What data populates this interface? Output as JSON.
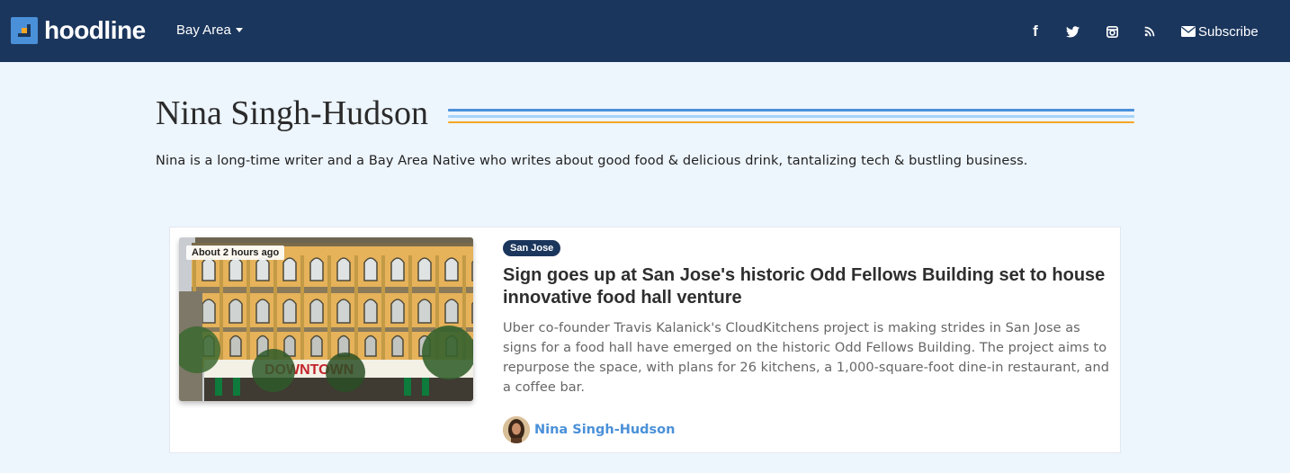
{
  "header": {
    "logo_text": "hoodline",
    "region_label": "Bay Area",
    "social": [
      "facebook-icon",
      "twitter-icon",
      "instagram-icon",
      "rss-icon"
    ],
    "facebook_glyph": "f",
    "subscribe_label": "Subscribe"
  },
  "author": {
    "name": "Nina Singh-Hudson",
    "bio": "Nina is a long-time writer and a Bay Area Native who writes about good food & delicious drink, tantalizing tech & bustling business."
  },
  "article": {
    "time_ago": "About 2 hours ago",
    "tag": "San Jose",
    "headline": "Sign goes up at San Jose's historic Odd Fellows Building set to house innovative food hall venture",
    "summary": "Uber co-founder Travis Kalanick's CloudKitchens project is making strides in San Jose as signs for a food hall have emerged on the historic Odd Fellows Building. The project aims to repurpose the space, with plans for 26 kitchens, a 1,000-square-foot dine-in restaurant, and a coffee bar.",
    "author_name": "Nina Singh-Hudson",
    "image_sign_text": "DOWNTOWN"
  },
  "colors": {
    "navbar": "#1b365d",
    "accent_blue": "#4a90d9",
    "accent_light_blue": "#a6d4f7",
    "accent_orange": "#f5a623",
    "page_bg": "#edf5fd"
  }
}
